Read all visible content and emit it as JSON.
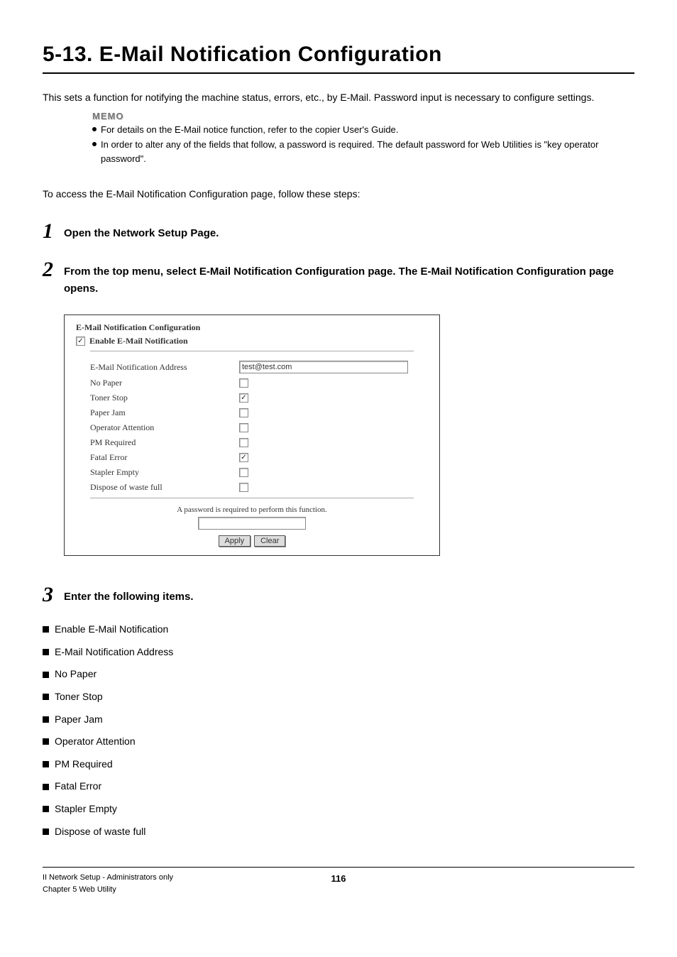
{
  "title": "5-13. E-Mail Notification Configuration",
  "intro": "This sets a function for notifying the machine status, errors, etc., by E-Mail. Password input is necessary to configure settings.",
  "memo": {
    "label": "MEMO",
    "items": [
      "For details on the E-Mail notice function, refer to the copier User's Guide.",
      "In order to alter any of the fields that follow, a password is required. The default password for Web Utilities is \"key operator password\"."
    ]
  },
  "access_line": "To access the E-Mail Notification Configuration page, follow these steps:",
  "steps": {
    "s1_num": "1",
    "s1_text": "Open the Network Setup Page.",
    "s2_num": "2",
    "s2_text": "From the top menu, select E-Mail Notification Configuration page. The E-Mail Notification Configuration page opens.",
    "s3_num": "3",
    "s3_text": "Enter the following items."
  },
  "screenshot": {
    "heading": "E-Mail Notification Configuration",
    "enable_label": "Enable E-Mail Notification",
    "enable_checked": "✓",
    "address_label": "E-Mail Notification Address",
    "address_value": "test@test.com",
    "rows": [
      {
        "label": "No Paper",
        "checked": ""
      },
      {
        "label": "Toner Stop",
        "checked": "✓"
      },
      {
        "label": "Paper Jam",
        "checked": ""
      },
      {
        "label": "Operator Attention",
        "checked": ""
      },
      {
        "label": "PM Required",
        "checked": ""
      },
      {
        "label": "Fatal Error",
        "checked": "✓"
      },
      {
        "label": "Stapler Empty",
        "checked": ""
      },
      {
        "label": "Dispose of waste full",
        "checked": ""
      }
    ],
    "password_msg": "A password is required to perform this function.",
    "apply_btn": "Apply",
    "clear_btn": "Clear"
  },
  "items_list": [
    "Enable E-Mail Notification",
    "E-Mail Notification Address",
    "No Paper",
    "Toner Stop",
    "Paper Jam",
    "Operator Attention",
    "PM Required",
    "Fatal Error",
    "Stapler Empty",
    "Dispose of waste full"
  ],
  "footer": {
    "line1": "II Network Setup - Administrators only",
    "line2": "Chapter 5 Web Utility",
    "pagenum": "116"
  }
}
